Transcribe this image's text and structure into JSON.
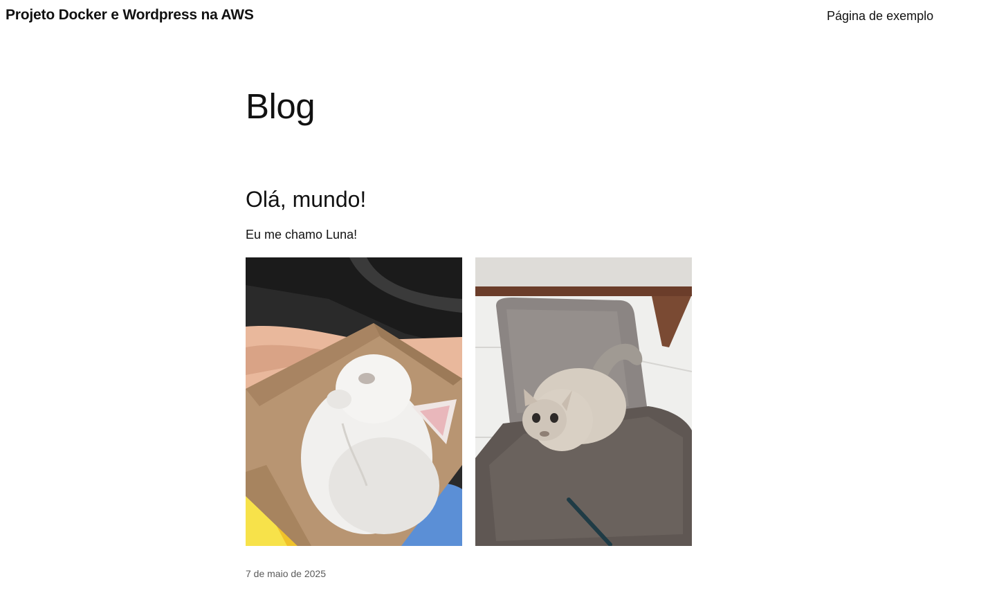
{
  "header": {
    "site_title": "Projeto Docker e Wordpress na AWS",
    "nav": [
      {
        "label": "Página de exemplo"
      }
    ]
  },
  "main": {
    "page_title": "Blog",
    "posts": [
      {
        "title": "Olá, mundo!",
        "excerpt": "Eu me chamo Luna!",
        "date": "7 de maio de 2025",
        "images": [
          {
            "description": "white-kitten-in-cardboard-box"
          },
          {
            "description": "cat-sitting-on-grey-chair"
          }
        ]
      }
    ]
  }
}
